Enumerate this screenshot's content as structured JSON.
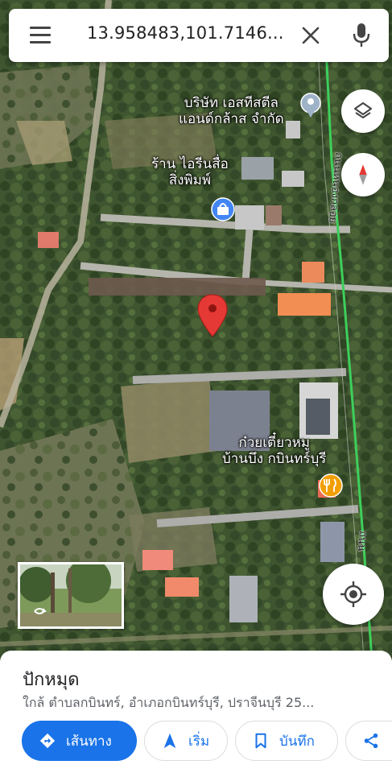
{
  "search": {
    "query": "13.958483,101.7146..."
  },
  "map": {
    "labels": [
      {
        "id": "company",
        "lines": [
          "บริษัท เอสทีสตีล",
          "แอนด์กล้าส จำกัด"
        ]
      },
      {
        "id": "shop",
        "lines": [
          "ร้าน ไอรีนสื่อ",
          "สิ่งพิมพ์"
        ]
      },
      {
        "id": "noodle",
        "lines": [
          "ก๋วยเตี๋ยวหมู",
          "บ้านบึง กบินทร์บุรี"
        ]
      }
    ],
    "road_label_1": "ถนนหนองกลอย",
    "road_label_2": "ถนน",
    "colors": {
      "pin": "#e53935",
      "poi_blue": "#4285f4",
      "poi_orange": "#f29f05",
      "road_green": "#34a853"
    }
  },
  "place": {
    "title": "ปักหมุด",
    "address": "ใกล้ ตำบลกบินทร์, อำเภอกบินทร์บุรี, ปราจีนบุรี 25..."
  },
  "actions": {
    "directions": "เส้นทาง",
    "start": "เริ่ม",
    "save": "บันทึก"
  },
  "icons": [
    "menu-icon",
    "close-icon",
    "mic-icon",
    "layers-icon",
    "compass-icon",
    "my-location-icon",
    "street-view-icon",
    "directions-icon",
    "navigate-icon",
    "bookmark-icon",
    "share-icon",
    "red-pin-icon",
    "shopping-bag-icon",
    "restaurant-icon",
    "location-marker-icon"
  ]
}
